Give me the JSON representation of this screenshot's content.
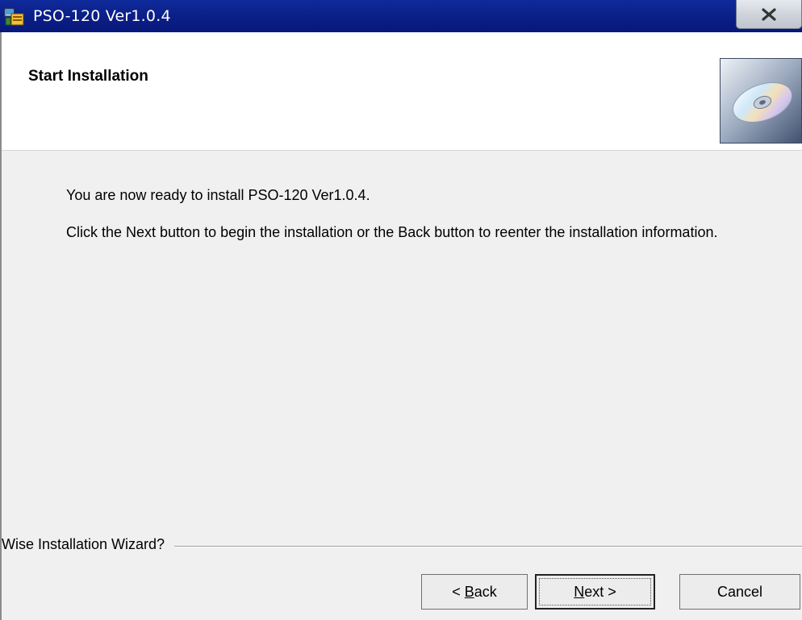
{
  "window": {
    "title": "PSO-120 Ver1.0.4",
    "icons": {
      "app": "installer-app-icon",
      "close": "close-icon"
    }
  },
  "header": {
    "title": "Start Installation",
    "image": "cd-disc-icon"
  },
  "body": {
    "line1": "You are now ready to install PSO-120 Ver1.0.4.",
    "line2": "Click the Next button to begin the installation or the Back button to reenter the installation information."
  },
  "footer": {
    "wizard_label": "Wise Installation Wizard?"
  },
  "buttons": {
    "back": {
      "prefix": "< ",
      "mnemonic": "B",
      "rest": "ack"
    },
    "next": {
      "mnemonic": "N",
      "rest": "ext >"
    },
    "cancel": {
      "label": "Cancel"
    }
  },
  "colors": {
    "titlebar": "#0a1f86",
    "window_bg": "#f0f0f0",
    "header_bg": "#ffffff"
  }
}
